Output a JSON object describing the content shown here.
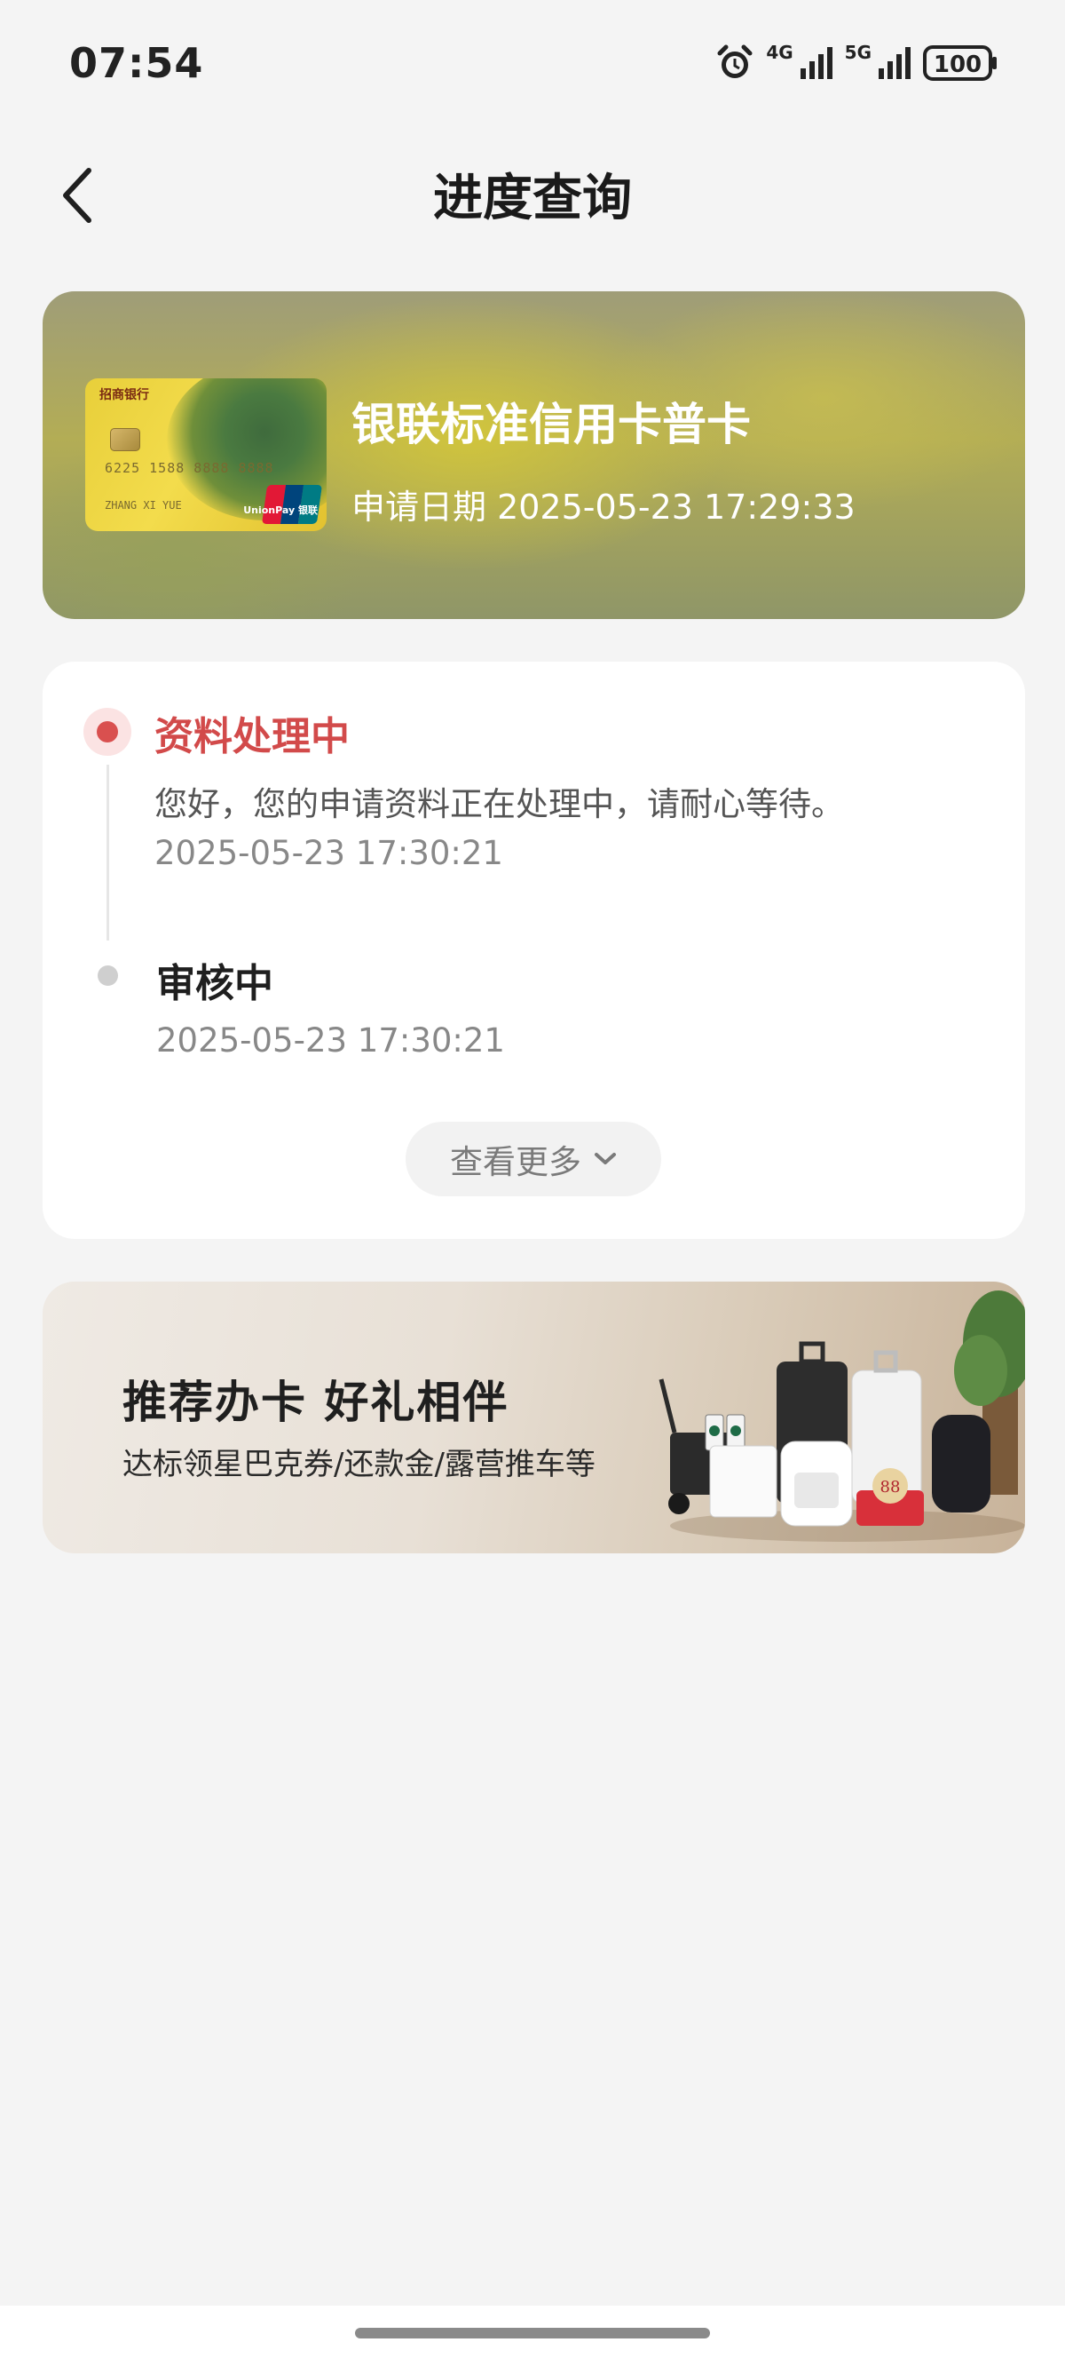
{
  "status_bar": {
    "time": "07:54",
    "network_1": "4G",
    "network_2": "5G",
    "battery": "100"
  },
  "header": {
    "title": "进度查询",
    "back_icon": "chevron-left-icon"
  },
  "card": {
    "name": "银联标准信用卡普卡",
    "apply_date": "申请日期 2025-05-23 17:29:33",
    "image_bank": "招商银行",
    "image_number": "6225 1588 8888 8888",
    "image_holder": "ZHANG XI YUE",
    "image_logo": "UnionPay 银联"
  },
  "progress": {
    "steps": [
      {
        "title": "资料处理中",
        "desc": "您好，您的申请资料正在处理中，请耐心等待。",
        "time": "2025-05-23 17:30:21",
        "status": "active"
      },
      {
        "title": "审核中",
        "time": "2025-05-23 17:30:21",
        "status": "inactive"
      }
    ],
    "more_label": "查看更多",
    "more_icon": "chevron-down-icon"
  },
  "promo": {
    "title": "推荐办卡 好礼相伴",
    "subtitle": "达标领星巴克券/还款金/露营推车等",
    "image_badge": "88"
  },
  "colors": {
    "accent": "#d24a4a",
    "page_bg": "#f4f4f4",
    "card_bg": "#ffffff"
  }
}
